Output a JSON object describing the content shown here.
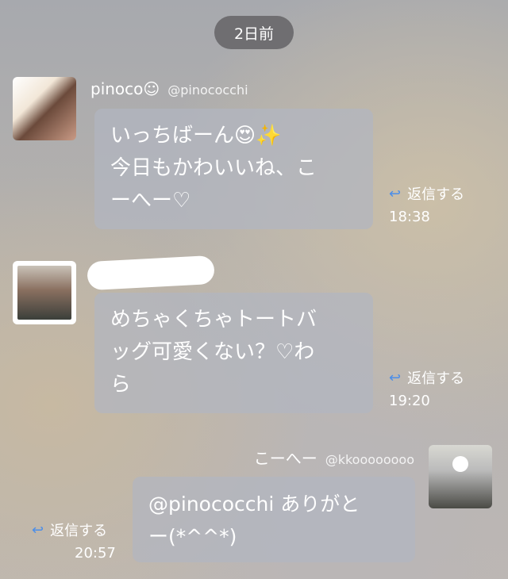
{
  "date_divider": "2日前",
  "messages": [
    {
      "name": "pinoco☺",
      "handle": "@pinococchi",
      "text": "いっちばーん😍✨\n今日もかわいいね、こ\nーへー♡",
      "reply": "返信する",
      "time": "18:38"
    },
    {
      "name": "",
      "handle": "",
      "text": "めちゃくちゃトートバ\nッグ可愛くない？♡わ\nら",
      "reply": "返信する",
      "time": "19:20"
    },
    {
      "name": "こーへー",
      "handle": "@kkoooooooo",
      "text": "@pinococchi ありがと\nー(*^^*)",
      "reply": "返信する",
      "time": "20:57"
    }
  ],
  "icons": {
    "reply": "reply-arrow-icon"
  },
  "colors": {
    "reply_arrow": "#4c8ee8",
    "date_pill": "#6f6e71"
  }
}
